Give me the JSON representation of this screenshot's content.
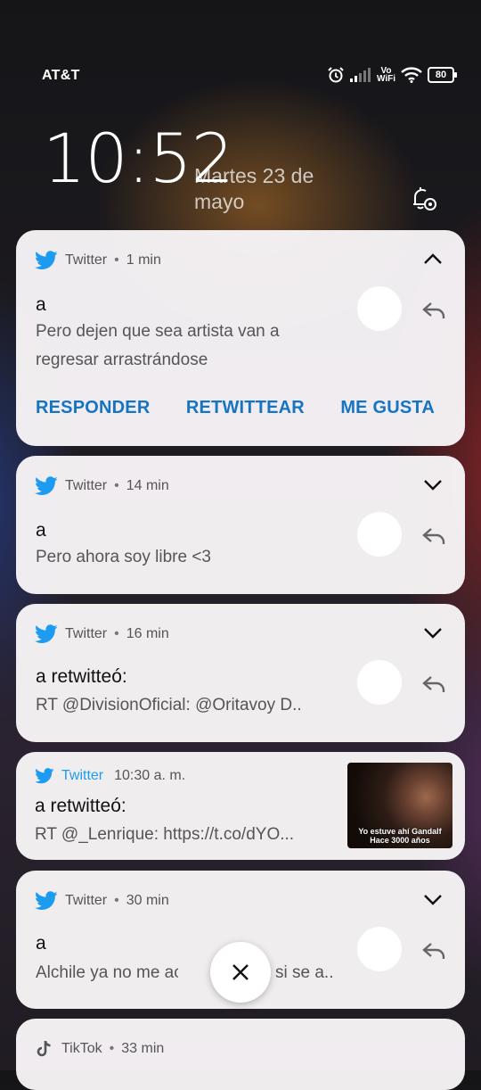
{
  "status_bar": {
    "carrier": "AT&T",
    "vowifi": [
      "Vo",
      "WiFi"
    ],
    "battery": "80",
    "icons": [
      "alarm-icon",
      "signal-icon",
      "vowifi-icon",
      "wifi-icon",
      "battery-icon"
    ]
  },
  "lockscreen": {
    "time": "10:52",
    "date": "Martes 23 de mayo"
  },
  "notifications": [
    {
      "app": "Twitter",
      "time": "1 min",
      "expanded": true,
      "title": "a",
      "lines": [
        "Pero dejen que sea artista van a",
        "regresar arrastrándose"
      ],
      "actions": [
        "RESPONDER",
        "RETWITTEAR",
        "ME GUSTA"
      ]
    },
    {
      "app": "Twitter",
      "time": "14 min",
      "title": "a",
      "body": "Pero ahora soy libre <3"
    },
    {
      "app": "Twitter",
      "time": "16 min",
      "title": "a retwitteó:",
      "body": "RT @DivisionOficial: @Oritavoy D.."
    },
    {
      "app": "Twitter",
      "time": "10:30 a. m.",
      "title": "a retwitteó:",
      "body": "RT @_Lenrique:  https://t.co/dYO...",
      "thumbnail_text": [
        "Yo estuve ahí Gandalf",
        "Hace 3000 años"
      ]
    },
    {
      "app": "Twitter",
      "time": "30 min",
      "title": "a",
      "body_left": "Alchile ya no me ac",
      "body_right": "si se a.."
    },
    {
      "app": "TikTok",
      "time": "33 min"
    }
  ],
  "colors": {
    "twitter_blue": "#1d9bf0",
    "action_blue": "#1575c2",
    "card_bg": "#f7f4f6"
  }
}
